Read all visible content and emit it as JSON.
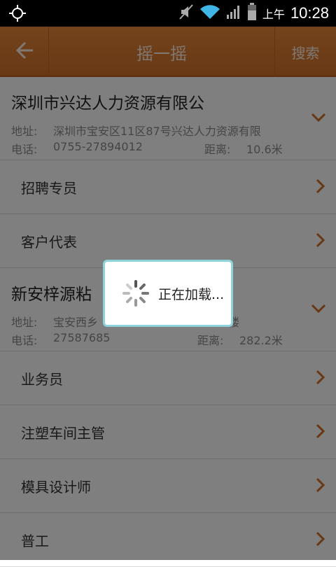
{
  "status_bar": {
    "ampm": "上午",
    "time": "10:28"
  },
  "titlebar": {
    "title": "摇一摇",
    "search_label": "搜索"
  },
  "companies": [
    {
      "name": "深圳市兴达人力资源有限公",
      "address_label": "地址:",
      "address": "深圳市宝安区11区87号兴达人力资源有限",
      "phone_label": "电话:",
      "phone": "0755-27894012",
      "distance_label": "距离:",
      "distance": "10.6米"
    },
    {
      "name": "新安梓源粘",
      "address_label": "地址:",
      "address": "宝安西乡",
      "address_tail": "楼",
      "phone_label": "电话:",
      "phone": "27587685",
      "distance_label": "距离:",
      "distance": "282.2米"
    }
  ],
  "jobs_group1": [
    "招聘专员",
    "客户代表"
  ],
  "jobs_group2": [
    "业务员",
    "注塑车间主管",
    "模具设计师",
    "普工"
  ],
  "loading": {
    "text": "正在加载..."
  },
  "colors": {
    "accent": "#e07a30",
    "dialog_border": "#8ed2dc"
  }
}
